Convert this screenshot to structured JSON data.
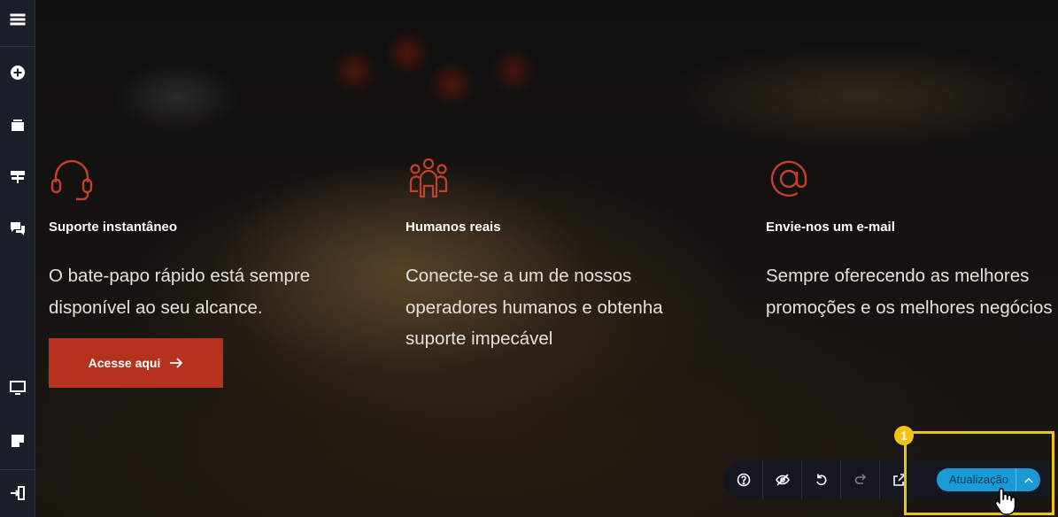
{
  "sidebar": {
    "icons": [
      "menu-icon",
      "add-circle-icon",
      "layers-icon",
      "navigator-icon",
      "comments-icon",
      "desktop-icon",
      "notes-icon",
      "exit-icon"
    ]
  },
  "features": [
    {
      "icon": "headset-icon",
      "title": "Suporte instantâneo",
      "text": "O bate-papo rápido está sempre disponível ao seu alcance."
    },
    {
      "icon": "people-icon",
      "title": "Humanos reais",
      "text": "Conecte-se a um de nossos operadores humanos e obtenha suporte impecável"
    },
    {
      "icon": "at-sign-icon",
      "title": "Envie-nos um e-mail",
      "text": "Sempre oferecendo as melhores promoções e os melhores negócios"
    }
  ],
  "cta": {
    "label": "Acesse aqui",
    "icon": "arrow-right-icon"
  },
  "toolbar": {
    "buttons": [
      "help-icon",
      "hide-icon",
      "undo-icon",
      "redo-icon",
      "preview-external-icon"
    ],
    "update_label": "Atualização"
  },
  "annotation": {
    "step": "1"
  },
  "colors": {
    "accent": "#b5321f",
    "update": "#1a9ad6",
    "highlight": "#f1c40f",
    "sidebar": "#1b1f29"
  }
}
